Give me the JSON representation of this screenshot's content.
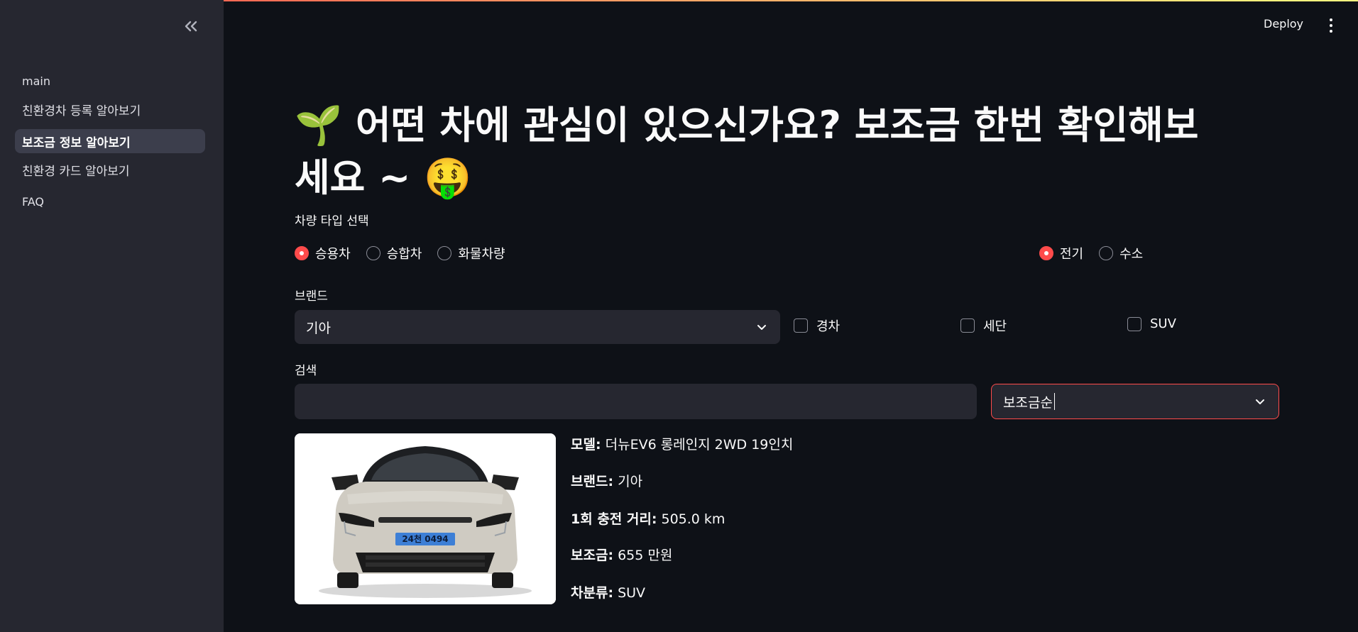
{
  "app": {
    "header": {
      "deploy_label": "Deploy"
    }
  },
  "sidebar": {
    "items": [
      {
        "label": "main"
      },
      {
        "label": "친환경차 등록 알아보기"
      },
      {
        "label": "보조금 정보 알아보기",
        "active": true
      },
      {
        "label": "친환경 카드 알아보기"
      },
      {
        "label": "FAQ"
      }
    ]
  },
  "main": {
    "title_line1": "🌱 어떤 차에 관심이 있으신가요? 보조금 한번 확인해보",
    "title_line2": "세요 ~ 🤑",
    "vehicle_type": {
      "label": "차량 타입 선택",
      "options": [
        "승용차",
        "승합차",
        "화물차량"
      ],
      "selected": "승용차"
    },
    "fuel_type": {
      "options": [
        "전기",
        "수소"
      ],
      "selected": "전기"
    },
    "brand": {
      "label": "브랜드",
      "selected": "기아"
    },
    "body_filters": [
      "경차",
      "세단",
      "SUV"
    ],
    "search": {
      "label": "검색",
      "value": "",
      "placeholder": ""
    },
    "sort": {
      "selected": "보조금순"
    },
    "result": {
      "model_label": "모델:",
      "model_value": "더뉴EV6 롱레인지 2WD 19인치",
      "brand_label": "브랜드:",
      "brand_value": "기아",
      "range_label": "1회 충전 거리:",
      "range_value": "505.0 km",
      "subsidy_label": "보조금:",
      "subsidy_value": "655 만원",
      "class_label": "차분류:",
      "class_value": "SUV",
      "plate_text": "24천 0494"
    }
  },
  "colors": {
    "accent": "#ff4b4b",
    "sidebar_bg": "#262730",
    "main_bg": "#0e1117"
  }
}
